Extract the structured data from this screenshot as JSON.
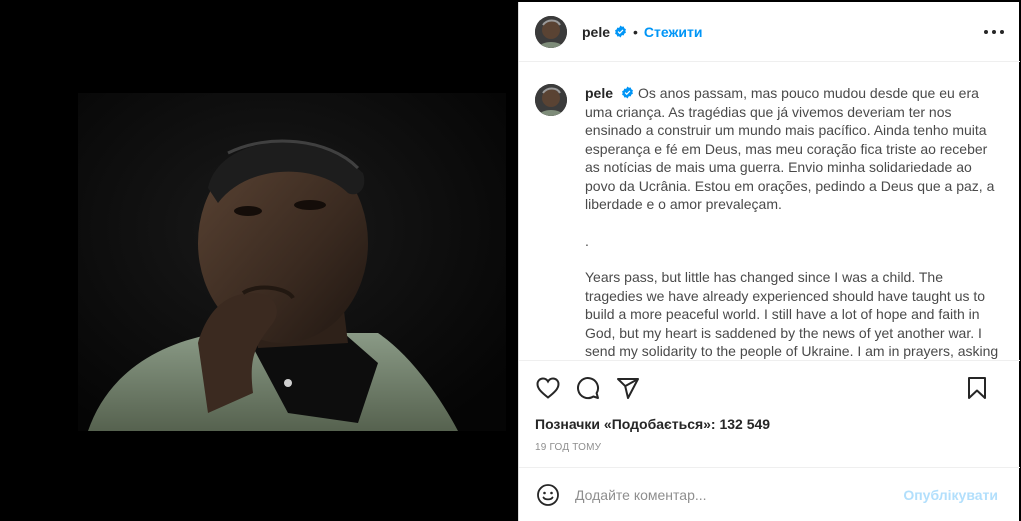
{
  "post": {
    "username": "pele",
    "follow_label": "Стежити",
    "dot": "•",
    "caption_pt": "Os anos passam, mas pouco mudou desde que eu era uma criança. As tragédias que já vivemos deveriam ter nos ensinado a construir um mundo mais pacífico. Ainda tenho muita esperança e fé em Deus, mas meu coração fica triste ao receber as notícias de mais uma guerra. Envio minha solidariedade ao povo da Ucrânia. Estou em orações, pedindo a Deus que a paz, a liberdade e o amor prevaleçam.",
    "separator": ".",
    "caption_en": "Years pass, but little has changed since I was a child. The tragedies we have already experienced should have taught us to build a more peaceful world. I still have a lot of hope and faith in God, but my heart is saddened by the news of yet another war. I send my solidarity to the people of Ukraine. I am in prayers, asking God for",
    "likes_label": "Позначки «Подобається»: 132 549",
    "time_label": "19 год тому"
  },
  "comment": {
    "placeholder": "Додайте коментар...",
    "post_label": "Опублікувати"
  },
  "icons": {
    "verified": "verified-badge-icon",
    "more": "more-options-icon",
    "like": "heart-icon",
    "comment": "comment-icon",
    "share": "share-icon",
    "save": "bookmark-icon",
    "emoji": "emoji-icon"
  },
  "colors": {
    "accent": "#0095f6",
    "post_disabled": "#b2dffc",
    "muted": "#8e8e8e",
    "text": "#262626"
  }
}
